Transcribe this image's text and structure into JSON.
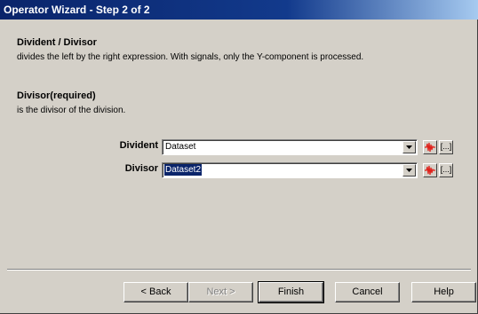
{
  "window": {
    "title": "Operator Wizard - Step 2 of 2"
  },
  "operator": {
    "heading": "Divident / Divisor",
    "description": "divides the left by the right expression. With signals, only the Y-component is processed."
  },
  "parameter": {
    "heading": "Divisor(required)",
    "description": "is the divisor of the division."
  },
  "fields": [
    {
      "label": "Divident",
      "value": "Dataset",
      "selected": false,
      "browse_label": "[...]"
    },
    {
      "label": "Divisor",
      "value": "Dataset2",
      "selected": true,
      "browse_label": "[...]"
    }
  ],
  "buttons": {
    "back": "< Back",
    "next": "Next >",
    "finish": "Finish",
    "cancel": "Cancel",
    "help": "Help"
  },
  "icons": {
    "signal": "signal-icon",
    "dropdown": "chevron-down-icon"
  },
  "colors": {
    "title_bar": "#0a246a",
    "selection": "#0a246a",
    "signal_icon": "#e0201a"
  }
}
